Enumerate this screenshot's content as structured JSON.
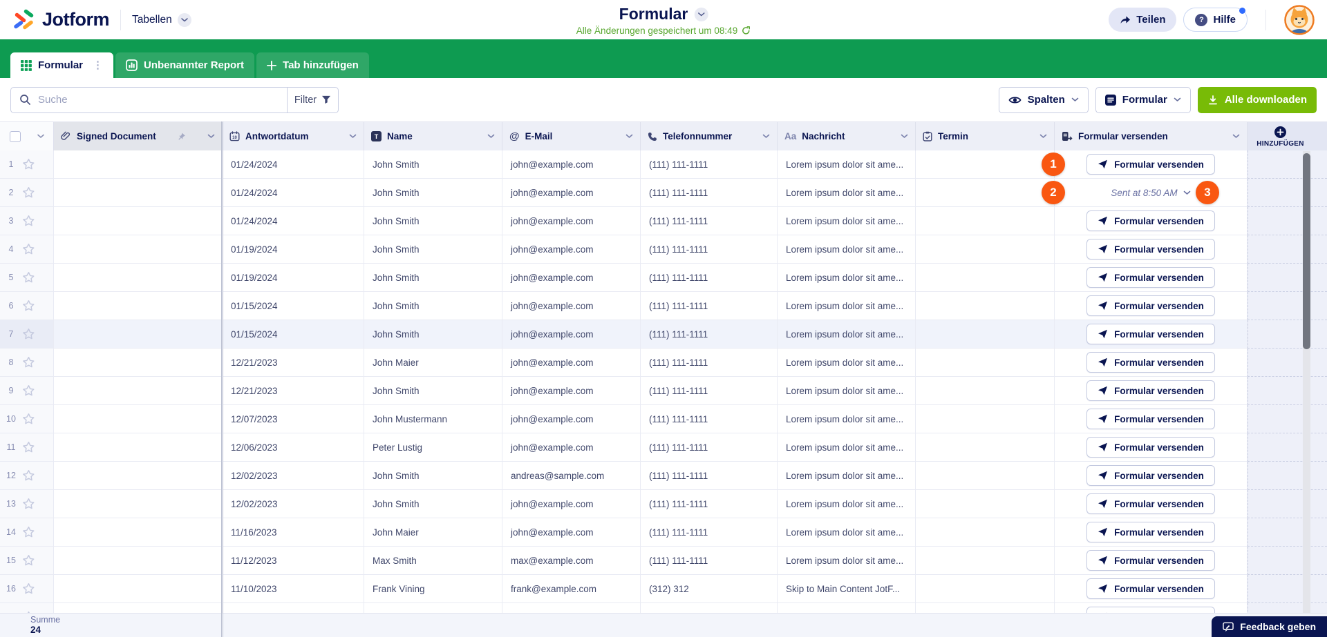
{
  "app": {
    "brand": "Jotform",
    "product": "Tabellen"
  },
  "header": {
    "title": "Formular",
    "status": "Alle Änderungen gespeichert um 08:49",
    "share": "Teilen",
    "help": "Hilfe"
  },
  "tabs": [
    {
      "label": "Formular",
      "active": true
    },
    {
      "label": "Unbenannter Report",
      "active": false
    },
    {
      "label": "Tab hinzufügen",
      "active": false
    }
  ],
  "toolbar": {
    "search_placeholder": "Suche",
    "filter": "Filter",
    "columns": "Spalten",
    "form": "Formular",
    "download": "Alle downloaden"
  },
  "table": {
    "columns": [
      "Signed Document",
      "Antwortdatum",
      "Name",
      "E-Mail",
      "Telefonnummer",
      "Nachricht",
      "Termin",
      "Formular versenden"
    ],
    "add_column": "HINZUFÜGEN",
    "send_button": "Formular versenden",
    "sent_status": "Sent at 8:50 AM",
    "rows": [
      {
        "num": "1",
        "date": "01/24/2024",
        "name": "John Smith",
        "email": "john@example.com",
        "phone": "(111) 111-1111",
        "message": "Lorem ipsum dolor sit ame...",
        "action": "button"
      },
      {
        "num": "2",
        "date": "01/24/2024",
        "name": "John Smith",
        "email": "john@example.com",
        "phone": "(111) 111-1111",
        "message": "Lorem ipsum dolor sit ame...",
        "action": "sent"
      },
      {
        "num": "3",
        "date": "01/24/2024",
        "name": "John Smith",
        "email": "john@example.com",
        "phone": "(111) 111-1111",
        "message": "Lorem ipsum dolor sit ame...",
        "action": "button"
      },
      {
        "num": "4",
        "date": "01/19/2024",
        "name": "John Smith",
        "email": "john@example.com",
        "phone": "(111) 111-1111",
        "message": "Lorem ipsum dolor sit ame...",
        "action": "button"
      },
      {
        "num": "5",
        "date": "01/19/2024",
        "name": "John Smith",
        "email": "john@example.com",
        "phone": "(111) 111-1111",
        "message": "Lorem ipsum dolor sit ame...",
        "action": "button"
      },
      {
        "num": "6",
        "date": "01/15/2024",
        "name": "John Smith",
        "email": "john@example.com",
        "phone": "(111) 111-1111",
        "message": "Lorem ipsum dolor sit ame...",
        "action": "button"
      },
      {
        "num": "7",
        "date": "01/15/2024",
        "name": "John Smith",
        "email": "john@example.com",
        "phone": "(111) 111-1111",
        "message": "Lorem ipsum dolor sit ame...",
        "action": "button",
        "highlighted": true
      },
      {
        "num": "8",
        "date": "12/21/2023",
        "name": "John Maier",
        "email": "john@example.com",
        "phone": "(111) 111-1111",
        "message": "Lorem ipsum dolor sit ame...",
        "action": "button"
      },
      {
        "num": "9",
        "date": "12/21/2023",
        "name": "John Smith",
        "email": "john@example.com",
        "phone": "(111) 111-1111",
        "message": "Lorem ipsum dolor sit ame...",
        "action": "button"
      },
      {
        "num": "10",
        "date": "12/07/2023",
        "name": "John Mustermann",
        "email": "john@example.com",
        "phone": "(111) 111-1111",
        "message": "Lorem ipsum dolor sit ame...",
        "action": "button"
      },
      {
        "num": "11",
        "date": "12/06/2023",
        "name": "Peter Lustig",
        "email": "john@example.com",
        "phone": "(111) 111-1111",
        "message": "Lorem ipsum dolor sit ame...",
        "action": "button"
      },
      {
        "num": "12",
        "date": "12/02/2023",
        "name": "John Smith",
        "email": "andreas@sample.com",
        "phone": "(111) 111-1111",
        "message": "Lorem ipsum dolor sit ame...",
        "action": "button"
      },
      {
        "num": "13",
        "date": "12/02/2023",
        "name": "John Smith",
        "email": "john@example.com",
        "phone": "(111) 111-1111",
        "message": "Lorem ipsum dolor sit ame...",
        "action": "button"
      },
      {
        "num": "14",
        "date": "11/16/2023",
        "name": "John Maier",
        "email": "john@example.com",
        "phone": "(111) 111-1111",
        "message": "Lorem ipsum dolor sit ame...",
        "action": "button"
      },
      {
        "num": "15",
        "date": "11/12/2023",
        "name": "Max Smith",
        "email": "max@example.com",
        "phone": "(111) 111-1111",
        "message": "Lorem ipsum dolor sit ame...",
        "action": "button"
      },
      {
        "num": "16",
        "date": "11/10/2023",
        "name": "Frank Vining",
        "email": "frank@example.com",
        "phone": "(312) 312",
        "message": "Skip to Main Content JotF...",
        "action": "button"
      },
      {
        "num": "",
        "date": "",
        "name": "",
        "email": "",
        "phone": "",
        "message": "",
        "action": "button",
        "partial": true
      }
    ]
  },
  "annotations": [
    "1",
    "2",
    "3"
  ],
  "footer": {
    "sum_label": "Summe",
    "sum_value": "24",
    "feedback": "Feedback geben"
  },
  "colors": {
    "brand_navy": "#0A1551",
    "tabbar_green": "#0E9B51",
    "tab_green": "#2FA767",
    "download_green": "#78BB07",
    "status_green": "#58A72F",
    "annotation_orange": "#F95711",
    "header_bg": "#EDEFF7"
  }
}
